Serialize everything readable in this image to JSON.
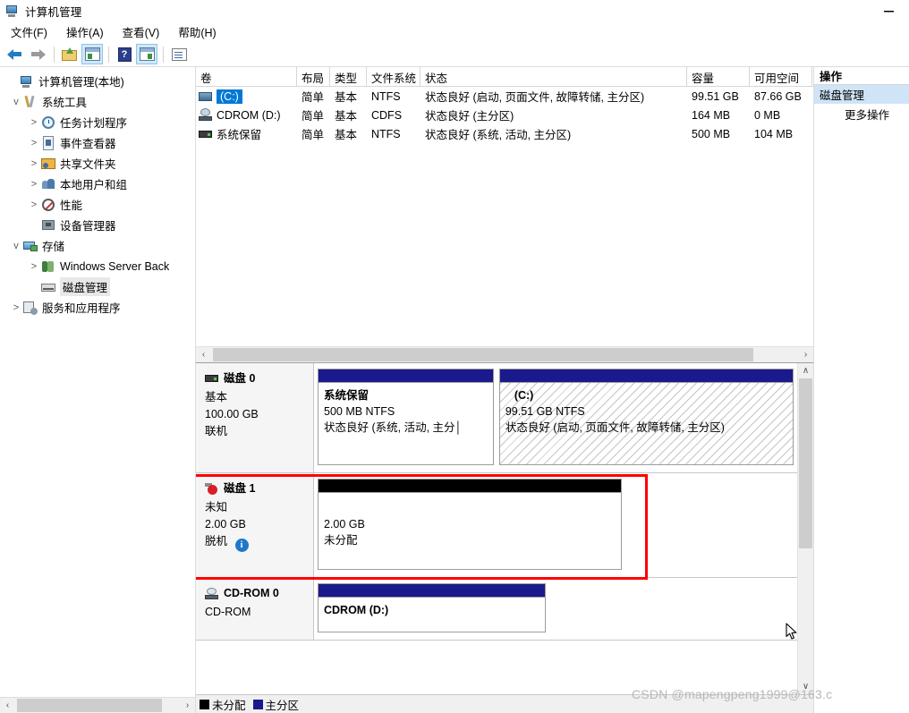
{
  "window": {
    "title": "计算机管理",
    "app_icon": "computer-management-icon",
    "minimize_label": "最小化"
  },
  "menubar": [
    {
      "label": "文件(F)",
      "name": "menu-file"
    },
    {
      "label": "操作(A)",
      "name": "menu-action"
    },
    {
      "label": "查看(V)",
      "name": "menu-view"
    },
    {
      "label": "帮助(H)",
      "name": "menu-help"
    }
  ],
  "toolbar": [
    {
      "name": "back-button",
      "icon": "arrow-left-icon",
      "active": false
    },
    {
      "name": "forward-button",
      "icon": "arrow-right-icon",
      "active": false
    },
    {
      "name": "up-one-level-button",
      "icon": "folder-up-icon",
      "active": false
    },
    {
      "name": "show-hide-console-tree-button",
      "icon": "console-tree-icon",
      "active": true
    },
    {
      "name": "help-button",
      "icon": "help-question-icon",
      "active": false
    },
    {
      "name": "show-hide-action-pane-button",
      "icon": "action-pane-icon",
      "active": true
    },
    {
      "name": "properties-button",
      "icon": "properties-icon",
      "active": false
    }
  ],
  "tree": {
    "items": [
      {
        "label": "计算机管理(本地)",
        "indent": 0,
        "expander": "",
        "icon": "computer-icon",
        "selected": false,
        "name": "tree-computer-management-local"
      },
      {
        "label": "系统工具",
        "indent": 1,
        "expander": "v",
        "icon": "system-tools-icon",
        "selected": false,
        "name": "tree-system-tools"
      },
      {
        "label": "任务计划程序",
        "indent": 2,
        "expander": ">",
        "icon": "task-scheduler-icon",
        "selected": false,
        "name": "tree-task-scheduler"
      },
      {
        "label": "事件查看器",
        "indent": 2,
        "expander": ">",
        "icon": "event-viewer-icon",
        "selected": false,
        "name": "tree-event-viewer"
      },
      {
        "label": "共享文件夹",
        "indent": 2,
        "expander": ">",
        "icon": "shared-folders-icon",
        "selected": false,
        "name": "tree-shared-folders"
      },
      {
        "label": "本地用户和组",
        "indent": 2,
        "expander": ">",
        "icon": "local-users-groups-icon",
        "selected": false,
        "name": "tree-local-users-and-groups"
      },
      {
        "label": "性能",
        "indent": 2,
        "expander": ">",
        "icon": "performance-icon",
        "selected": false,
        "name": "tree-performance"
      },
      {
        "label": "设备管理器",
        "indent": 2,
        "expander": "",
        "icon": "device-manager-icon",
        "selected": false,
        "name": "tree-device-manager"
      },
      {
        "label": "存储",
        "indent": 1,
        "expander": "v",
        "icon": "storage-icon",
        "selected": false,
        "name": "tree-storage"
      },
      {
        "label": "Windows Server Back",
        "indent": 2,
        "expander": ">",
        "icon": "windows-server-backup-icon",
        "selected": false,
        "name": "tree-windows-server-backup"
      },
      {
        "label": "磁盘管理",
        "indent": 2,
        "expander": "",
        "icon": "disk-management-icon",
        "selected": true,
        "name": "tree-disk-management"
      },
      {
        "label": "服务和应用程序",
        "indent": 1,
        "expander": ">",
        "icon": "services-applications-icon",
        "selected": false,
        "name": "tree-services-and-applications"
      }
    ],
    "hscroll": {
      "left_arrow": "‹",
      "right_arrow": "›"
    }
  },
  "volume_list": {
    "columns": [
      {
        "label": "卷",
        "key": "volume",
        "cls": "c-vol"
      },
      {
        "label": "布局",
        "key": "layout",
        "cls": "c-lay"
      },
      {
        "label": "类型",
        "key": "type",
        "cls": "c-typ"
      },
      {
        "label": "文件系统",
        "key": "fs",
        "cls": "c-fs"
      },
      {
        "label": "状态",
        "key": "status",
        "cls": "c-stat"
      },
      {
        "label": "容量",
        "key": "capacity",
        "cls": "c-cap"
      },
      {
        "label": "可用空间",
        "key": "free",
        "cls": "c-free"
      }
    ],
    "rows": [
      {
        "volume": "(C:)",
        "icon": "hard-disk-icon",
        "selected": true,
        "layout": "简单",
        "type": "基本",
        "fs": "NTFS",
        "status": "状态良好 (启动, 页面文件, 故障转储, 主分区)",
        "capacity": "99.51 GB",
        "free": "87.66 GB"
      },
      {
        "volume": "CDROM (D:)",
        "icon": "cdrom-icon",
        "selected": false,
        "layout": "简单",
        "type": "基本",
        "fs": "CDFS",
        "status": "状态良好 (主分区)",
        "capacity": "164 MB",
        "free": "0 MB"
      },
      {
        "volume": "系统保留",
        "icon": "system-reserved-icon",
        "selected": false,
        "layout": "简单",
        "type": "基本",
        "fs": "NTFS",
        "status": "状态良好 (系统, 活动, 主分区)",
        "capacity": "500 MB",
        "free": "104 MB"
      }
    ],
    "hscroll": {
      "left_arrow": "‹",
      "right_arrow": "›"
    }
  },
  "disks": [
    {
      "name": "disk-0",
      "title": "磁盘 0",
      "icon": "disk-online-icon",
      "lines": [
        "基本",
        "100.00 GB",
        "联机"
      ],
      "partitions": [
        {
          "name": "partition-system-reserved",
          "kind": "primary",
          "width_pct": 37,
          "hatched": false,
          "lines": [
            {
              "text": "系统保留",
              "bold": true
            },
            {
              "text": "500 MB NTFS",
              "bold": false
            },
            {
              "text": "状态良好 (系统, 活动, 主分│",
              "bold": false
            }
          ]
        },
        {
          "name": "partition-c-drive",
          "kind": "primary",
          "width_pct": 63,
          "hatched": true,
          "lines": [
            {
              "text": "(C:)",
              "bold": true
            },
            {
              "text": "99.51 GB NTFS",
              "bold": false
            },
            {
              "text": "状态良好 (启动, 页面文件, 故障转储, 主分区)",
              "bold": false
            }
          ]
        }
      ]
    },
    {
      "name": "disk-1",
      "title": "磁盘 1",
      "icon": "disk-offline-icon",
      "highlighted": true,
      "lines": [
        "未知",
        "2.00 GB",
        "脱机"
      ],
      "offline_badge": "i",
      "partitions": [
        {
          "name": "partition-unallocated",
          "kind": "unallocated",
          "width_pct": 64,
          "hatched": false,
          "lines": [
            {
              "text": "2.00 GB",
              "bold": false
            },
            {
              "text": "未分配",
              "bold": false
            }
          ]
        }
      ]
    },
    {
      "name": "cd-rom-0",
      "title": "CD-ROM 0",
      "icon": "cdrom-drive-icon",
      "lines": [
        "CD-ROM"
      ],
      "partitions": [
        {
          "name": "partition-cdrom-d",
          "kind": "primary",
          "width_pct": 48,
          "hatched": false,
          "lines": [
            {
              "text": "CDROM  (D:)",
              "bold": true
            }
          ]
        }
      ]
    }
  ],
  "legend": [
    {
      "label": "未分配",
      "color": "#000000",
      "name": "legend-unallocated"
    },
    {
      "label": "主分区",
      "color": "#1a1a8c",
      "name": "legend-primary-partition"
    }
  ],
  "actions": {
    "title": "操作",
    "section": "磁盘管理",
    "items": [
      {
        "label": "更多操作",
        "name": "actions-more-actions"
      }
    ]
  },
  "watermark": "CSDN @mapengpeng1999@163.c",
  "scroll_glyphs": {
    "up": "∧",
    "down": "∨",
    "left": "‹",
    "right": "›"
  },
  "colors": {
    "primary_partition": "#1a1a8c",
    "unallocated": "#000000",
    "selection": "#0078d7",
    "highlight_box": "#ff0000",
    "action_section": "#cfe4f7"
  }
}
